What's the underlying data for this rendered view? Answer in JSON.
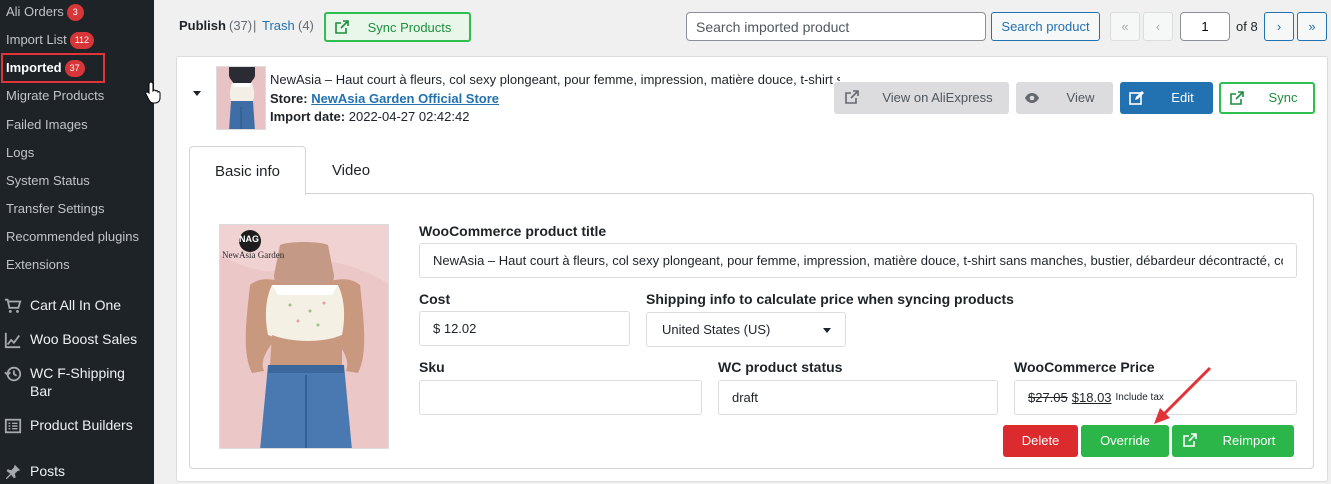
{
  "sidebar": {
    "submenu": [
      {
        "label": "Ali Orders",
        "count": "3"
      },
      {
        "label": "Import List",
        "count": "112"
      },
      {
        "label": "Imported",
        "count": "37"
      },
      {
        "label": "Migrate Products"
      },
      {
        "label": "Failed Images"
      },
      {
        "label": "Logs"
      },
      {
        "label": "System Status"
      },
      {
        "label": "Transfer Settings"
      },
      {
        "label": "Recommended plugins"
      },
      {
        "label": "Extensions"
      }
    ],
    "menu": [
      {
        "label": "Cart All In One",
        "icon": "cart-icon"
      },
      {
        "label": "Woo Boost Sales",
        "icon": "chart-line-icon"
      },
      {
        "label": "WC F-Shipping",
        "label2": "Bar",
        "icon": "history-icon"
      },
      {
        "label": "Product Builders",
        "icon": "list-icon"
      },
      {
        "label": "Posts",
        "icon": "pin-icon"
      }
    ]
  },
  "toolbar": {
    "publish_label": "Publish",
    "publish_count": "(37)",
    "separator": "|",
    "trash_label": "Trash",
    "trash_count": "(4)",
    "sync_products_label": "Sync Products",
    "search_placeholder": "Search imported product",
    "search_button": "Search product",
    "pagination": {
      "first": "«",
      "prev": "‹",
      "current": "1",
      "of_text": "of 8",
      "next": "›",
      "last": "»"
    }
  },
  "product": {
    "title": "NewAsia – Haut court à fleurs, col sexy plongeant, pour femme, impression, matière douce, t-shirt sans",
    "store_label": "Store:",
    "store_name": "NewAsia Garden Official Store",
    "date_label": "Import date:",
    "date_value": "2022-04-27 02:42:42",
    "actions": {
      "view_ali": "View on AliExpress",
      "view": "View",
      "edit": "Edit",
      "sync": "Sync"
    }
  },
  "tabs": [
    {
      "label": "Basic info"
    },
    {
      "label": "Video"
    }
  ],
  "form": {
    "image_logo_text": "NAG",
    "image_brand_text": "NewAsia Garden",
    "title_label": "WooCommerce product title",
    "title_value": "NewAsia – Haut court à fleurs, col sexy plongeant, pour femme, impression, matière douce, t-shirt sans manches, bustier, débardeur décontracté, corset",
    "cost_label": "Cost",
    "cost_value": "$ 12.02",
    "shipping_label": "Shipping info to calculate price when syncing products",
    "shipping_value": "United States (US)",
    "sku_label": "Sku",
    "sku_value": "",
    "status_label": "WC product status",
    "status_value": "draft",
    "price_label": "WooCommerce Price",
    "price_old": "$27.05",
    "price_new": "$18.03",
    "price_tax": "Include tax",
    "buttons": {
      "delete": "Delete",
      "override": "Override",
      "reimport": "Reimport"
    }
  },
  "colors": {
    "sidebar_bg": "#1d2327",
    "badge": "#d63638",
    "primary": "#2271b1",
    "success": "#2cb64a",
    "danger": "#dc2b2f",
    "annotation": "#e0333a"
  }
}
